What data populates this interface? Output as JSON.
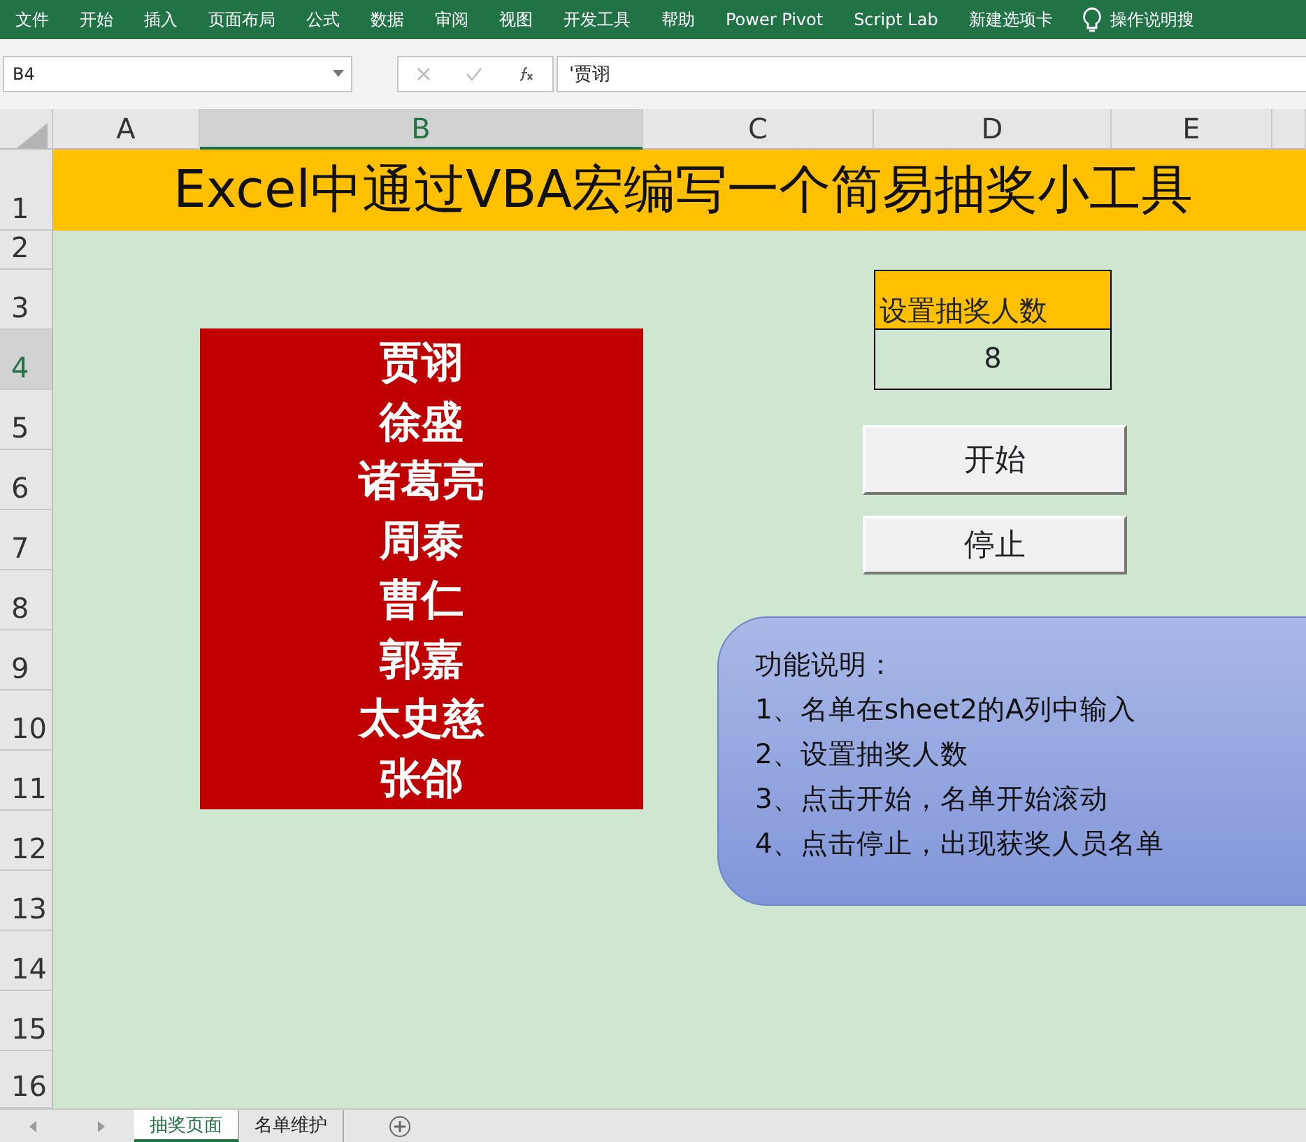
{
  "ribbon_tabs": [
    {
      "label": "文件"
    },
    {
      "label": "开始"
    },
    {
      "label": "插入"
    },
    {
      "label": "页面布局"
    },
    {
      "label": "公式"
    },
    {
      "label": "数据"
    },
    {
      "label": "审阅"
    },
    {
      "label": "视图"
    },
    {
      "label": "开发工具"
    },
    {
      "label": "帮助"
    },
    {
      "label": "Power Pivot"
    },
    {
      "label": "Script Lab"
    },
    {
      "label": "新建选项卡"
    }
  ],
  "tell_me": "操作说明搜",
  "formula_bar": {
    "name_box": "B4",
    "formula": "'贾诩"
  },
  "columns": [
    {
      "label": "A",
      "selected": false
    },
    {
      "label": "B",
      "selected": true
    },
    {
      "label": "C",
      "selected": false
    },
    {
      "label": "D",
      "selected": false
    },
    {
      "label": "E",
      "selected": false
    }
  ],
  "rows": [
    {
      "label": "1",
      "selected": false
    },
    {
      "label": "2",
      "selected": false
    },
    {
      "label": "3",
      "selected": false
    },
    {
      "label": "4",
      "selected": true
    },
    {
      "label": "5",
      "selected": false
    },
    {
      "label": "6",
      "selected": false
    },
    {
      "label": "7",
      "selected": false
    },
    {
      "label": "8",
      "selected": false
    },
    {
      "label": "9",
      "selected": false
    },
    {
      "label": "10",
      "selected": false
    },
    {
      "label": "11",
      "selected": false
    },
    {
      "label": "12",
      "selected": false
    },
    {
      "label": "13",
      "selected": false
    },
    {
      "label": "14",
      "selected": false
    },
    {
      "label": "15",
      "selected": false
    },
    {
      "label": "16",
      "selected": false
    }
  ],
  "title": "Excel中通过VBA宏编写一个简易抽奖小工具",
  "winners": [
    "贾诩",
    "徐盛",
    "诸葛亮",
    "周泰",
    "曹仁",
    "郭嘉",
    "太史慈",
    "张郃"
  ],
  "setting": {
    "label": "设置抽奖人数",
    "value": "8"
  },
  "buttons": [
    "开始",
    "停止"
  ],
  "instructions": [
    "功能说明：",
    "1、名单在sheet2的A列中输入",
    "2、设置抽奖人数",
    "3、点击开始，名单开始滚动",
    "4、点击停止，出现获奖人员名单"
  ],
  "sheet_tabs": [
    {
      "label": "抽奖页面",
      "selected": true
    },
    {
      "label": "名单维护",
      "selected": false
    }
  ]
}
